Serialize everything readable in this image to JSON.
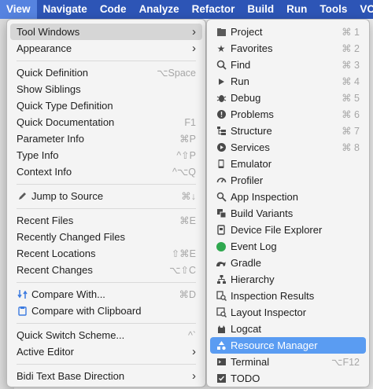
{
  "menubar": [
    "View",
    "Navigate",
    "Code",
    "Analyze",
    "Refactor",
    "Build",
    "Run",
    "Tools",
    "VC"
  ],
  "view_menu": {
    "tool_windows": "Tool Windows",
    "appearance": "Appearance",
    "quick_definition": {
      "label": "Quick Definition",
      "shortcut": "⌥Space"
    },
    "show_siblings": "Show Siblings",
    "quick_type_definition": "Quick Type Definition",
    "quick_documentation": {
      "label": "Quick Documentation",
      "shortcut": "F1"
    },
    "parameter_info": {
      "label": "Parameter Info",
      "shortcut": "⌘P"
    },
    "type_info": {
      "label": "Type Info",
      "shortcut": "^⇧P"
    },
    "context_info": {
      "label": "Context Info",
      "shortcut": "^⌥Q"
    },
    "jump_to_source": {
      "label": "Jump to Source",
      "shortcut": "⌘↓"
    },
    "recent_files": {
      "label": "Recent Files",
      "shortcut": "⌘E"
    },
    "recently_changed_files": "Recently Changed Files",
    "recent_locations": {
      "label": "Recent Locations",
      "shortcut": "⇧⌘E"
    },
    "recent_changes": {
      "label": "Recent Changes",
      "shortcut": "⌥⇧C"
    },
    "compare_with": {
      "label": "Compare With...",
      "shortcut": "⌘D"
    },
    "compare_with_clipboard": "Compare with Clipboard",
    "quick_switch_scheme": {
      "label": "Quick Switch Scheme...",
      "shortcut": "^`"
    },
    "active_editor": "Active Editor",
    "bidi_text_base_direction": "Bidi Text Base Direction"
  },
  "tool_windows_menu": {
    "project": {
      "label": "Project",
      "shortcut": "⌘ 1",
      "icon": "folder-icon"
    },
    "favorites": {
      "label": "Favorites",
      "shortcut": "⌘ 2",
      "icon": "star-icon"
    },
    "find": {
      "label": "Find",
      "shortcut": "⌘ 3",
      "icon": "search-icon"
    },
    "run": {
      "label": "Run",
      "shortcut": "⌘ 4",
      "icon": "play-icon"
    },
    "debug": {
      "label": "Debug",
      "shortcut": "⌘ 5",
      "icon": "bug-icon"
    },
    "problems": {
      "label": "Problems",
      "shortcut": "⌘ 6",
      "icon": "warning-icon"
    },
    "structure": {
      "label": "Structure",
      "shortcut": "⌘ 7",
      "icon": "structure-icon"
    },
    "services": {
      "label": "Services",
      "shortcut": "⌘ 8",
      "icon": "services-icon"
    },
    "emulator": {
      "label": "Emulator",
      "icon": "phone-icon"
    },
    "profiler": {
      "label": "Profiler",
      "icon": "gauge-icon"
    },
    "app_inspection": {
      "label": "App Inspection",
      "icon": "inspection-icon"
    },
    "build_variants": {
      "label": "Build Variants",
      "icon": "variants-icon"
    },
    "device_file_explorer": {
      "label": "Device File Explorer",
      "icon": "device-icon"
    },
    "event_log": {
      "label": "Event Log",
      "icon": "event-log-icon"
    },
    "gradle": {
      "label": "Gradle",
      "icon": "gradle-icon"
    },
    "hierarchy": {
      "label": "Hierarchy",
      "icon": "hierarchy-icon"
    },
    "inspection_results": {
      "label": "Inspection Results",
      "icon": "inspection-results-icon"
    },
    "layout_inspector": {
      "label": "Layout Inspector",
      "icon": "layout-inspector-icon"
    },
    "logcat": {
      "label": "Logcat",
      "icon": "logcat-icon"
    },
    "resource_manager": {
      "label": "Resource Manager",
      "icon": "resource-manager-icon"
    },
    "terminal": {
      "label": "Terminal",
      "shortcut": "⌥F12",
      "icon": "terminal-icon"
    },
    "todo": {
      "label": "TODO",
      "icon": "todo-icon"
    }
  },
  "colors": {
    "menubar": "#2d55b6",
    "menubar_active": "#5683e0",
    "selection": "#5a9cf2",
    "event_log_dot": "#2fa84f"
  }
}
